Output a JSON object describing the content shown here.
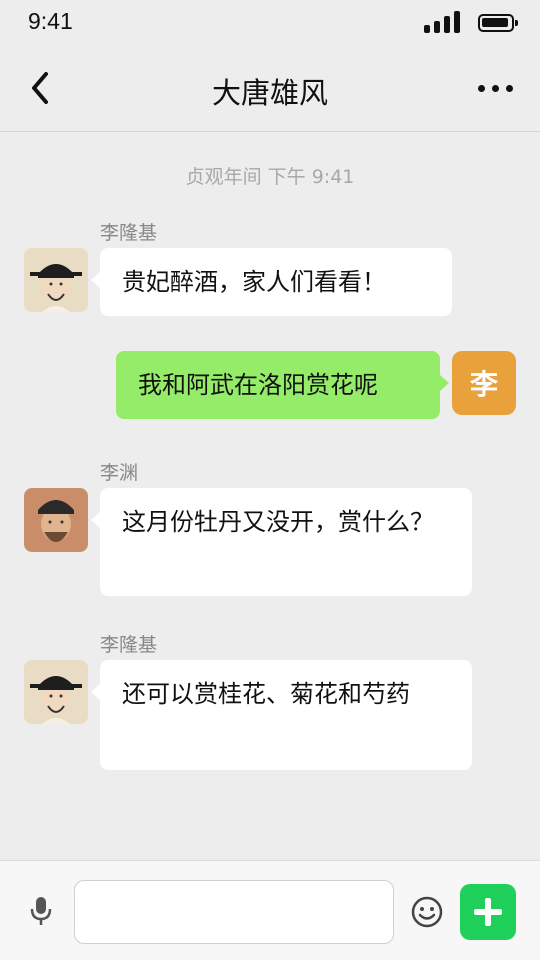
{
  "status_bar": {
    "time": "9:41"
  },
  "nav": {
    "title": "大唐雄风",
    "back_icon": "back-arrow-icon",
    "more_icon": "more-dots-icon"
  },
  "chat": {
    "timestamp": "贞观年间 下午 9:41",
    "messages": [
      {
        "sender": "李隆基",
        "text": "贵妃醉酒，家人们看看！",
        "side": "left",
        "avatar": "emperor-portrait"
      },
      {
        "sender": "",
        "text": "我和阿武在洛阳赏花呢",
        "side": "right",
        "avatar_letter": "李"
      },
      {
        "sender": "李渊",
        "text": "这月份牡丹又没开，赏什么？",
        "side": "left",
        "avatar": "emperor-portrait"
      },
      {
        "sender": "李隆基",
        "text": "还可以赏桂花、菊花和芍药",
        "side": "left",
        "avatar": "emperor-portrait"
      }
    ]
  },
  "input_bar": {
    "value": "",
    "placeholder": ""
  },
  "colors": {
    "background": "#ededed",
    "mine_bubble": "#95ec69",
    "their_bubble": "#ffffff",
    "letter_avatar": "#e9a23b",
    "plus_button": "#1fd15a"
  }
}
